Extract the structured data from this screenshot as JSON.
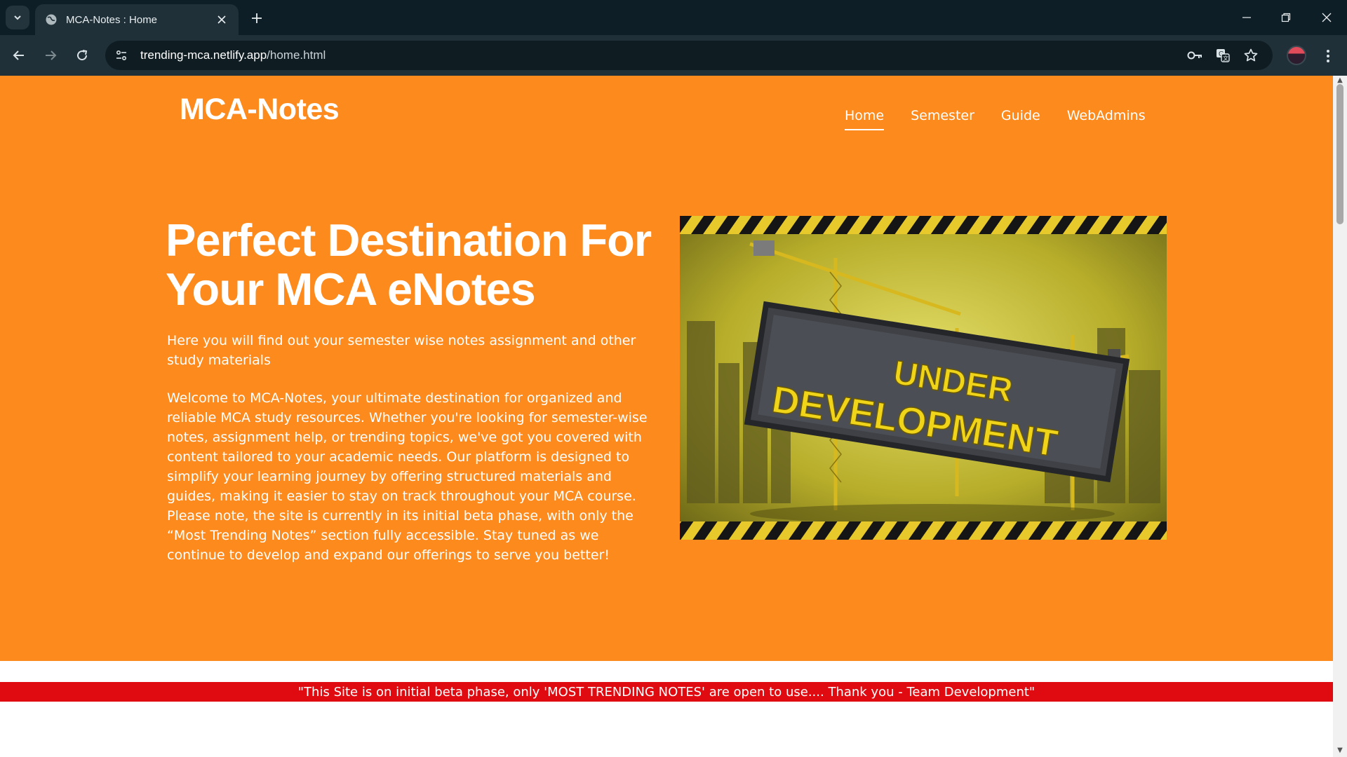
{
  "browser": {
    "tab": {
      "title": "MCA-Notes : Home",
      "favicon": "globe-icon"
    },
    "url": {
      "host": "trending-mca.netlify.app",
      "path": "/home.html"
    },
    "icons": [
      "tab-search-icon",
      "close-icon",
      "plus-icon",
      "minimize-icon",
      "restore-icon",
      "window-close-icon",
      "back-arrow-icon",
      "forward-arrow-icon",
      "reload-icon",
      "site-info-icon",
      "password-key-icon",
      "translate-icon",
      "bookmark-star-icon",
      "profile-avatar",
      "kebab-menu-icon"
    ]
  },
  "page": {
    "brand": "MCA-Notes",
    "nav": [
      {
        "label": "Home",
        "active": true
      },
      {
        "label": "Semester",
        "active": false
      },
      {
        "label": "Guide",
        "active": false
      },
      {
        "label": "WebAdmins",
        "active": false
      }
    ],
    "headline": "Perfect Destination For Your MCA eNotes",
    "subhead": "Here you will find out your semester wise notes assignment and other study materials",
    "body": "Welcome to MCA-Notes, your ultimate destination for organized and reliable MCA study resources. Whether you're looking for semester-wise notes, assignment help, or trending topics, we've got you covered with content tailored to your academic needs. Our platform is designed to simplify your learning journey by offering structured materials and guides, making it easier to stay on track throughout your MCA course. Please note, the site is currently in its initial beta phase, with only the “Most Trending Notes” section fully accessible. Stay tuned as we continue to develop and expand our offerings to serve you better!",
    "image": {
      "line1": "UNDER",
      "line2": "DEVELOPMENT"
    },
    "banner": "\"This Site is on initial beta phase, only 'MOST TRENDING NOTES' are open to use.... Thank you - Team Development\""
  },
  "colors": {
    "hero_bg": "#fd8a1c",
    "banner_bg": "#e00b10",
    "chrome_dark": "#0e1e26",
    "chrome_toolbar": "#1f3038"
  }
}
